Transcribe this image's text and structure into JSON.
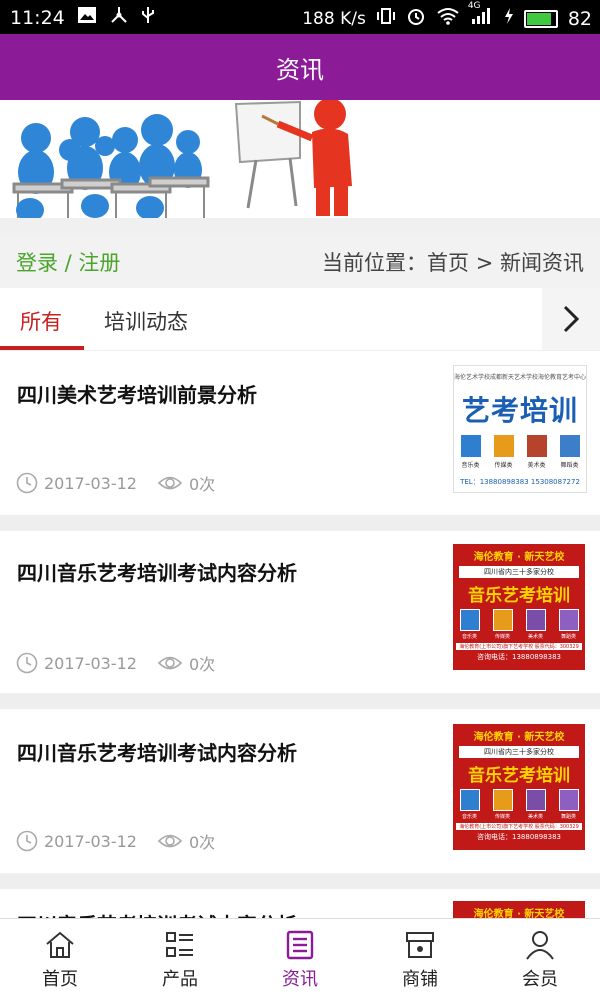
{
  "status_bar": {
    "time": "11:24",
    "net_speed": "188 K/s",
    "signal_type": "4G",
    "battery": "82",
    "battery_level": 0.82
  },
  "header": {
    "title": "资讯"
  },
  "login_bar": {
    "login_link": "登录 / 注册",
    "breadcrumb": "当前位置：首页 > 新闻资讯"
  },
  "tabs": [
    {
      "label": "所有",
      "active": true
    },
    {
      "label": "培训动态",
      "active": false
    }
  ],
  "articles": [
    {
      "title": "四川美术艺考培训前景分析",
      "date": "2017-03-12",
      "views": "0次",
      "thumb": {
        "top_logos": [
          "海伦艺术学校",
          "成都新天艺术学校",
          "海伦教育艺考中心"
        ],
        "headline": "艺考培训",
        "categories": [
          "音乐类",
          "传媒类",
          "美术类",
          "舞蹈类"
        ],
        "contact": "TEL：13880898383  15308087272"
      }
    },
    {
      "title": "四川音乐艺考培训考试内容分析",
      "date": "2017-03-12",
      "views": "0次",
      "thumb": {
        "slogan": "海伦教育 · 新天艺校",
        "subline": "四川省内三十多家分校",
        "headline": "音乐艺考培训",
        "categories": [
          "音乐类",
          "传媒类",
          "美术类",
          "舞蹈类"
        ],
        "footer1": "海伦教育(上市公司)旗下艺考学校 股票代码：300329",
        "footer2": "咨询电话：13880898383"
      }
    },
    {
      "title": "四川音乐艺考培训考试内容分析",
      "date": "2017-03-12",
      "views": "0次",
      "thumb": {
        "slogan": "海伦教育 · 新天艺校",
        "subline": "四川省内三十多家分校",
        "headline": "音乐艺考培训",
        "categories": [
          "音乐类",
          "传媒类",
          "美术类",
          "舞蹈类"
        ],
        "footer1": "海伦教育(上市公司)旗下艺考学校 股票代码：300329",
        "footer2": "咨询电话：13880898383"
      }
    },
    {
      "title": "四川音乐艺考培训考试内容分析",
      "thumb": {
        "slogan": "海伦教育 · 新天艺校"
      }
    }
  ],
  "tab_bar": [
    {
      "label": "首页",
      "icon": "home-icon",
      "active": false
    },
    {
      "label": "产品",
      "icon": "grid-list-icon",
      "active": false
    },
    {
      "label": "资讯",
      "icon": "news-icon",
      "active": true
    },
    {
      "label": "商铺",
      "icon": "shop-icon",
      "active": false
    },
    {
      "label": "会员",
      "icon": "user-icon",
      "active": false
    }
  ],
  "colors": {
    "header": "#8c1b98",
    "login_link": "#4aa52a",
    "tab_active": "#c8201e",
    "tabbar_active": "#8c1b98",
    "poster_red": "#c11818",
    "poster_yellow": "#ffd400"
  }
}
